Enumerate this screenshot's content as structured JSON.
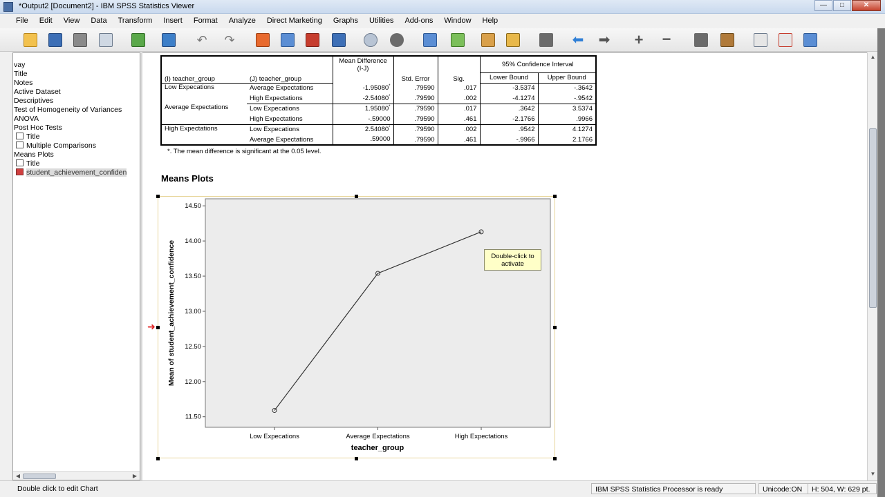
{
  "window": {
    "title": "*Output2 [Document2] - IBM SPSS Statistics Viewer",
    "minimize": "—",
    "maximize": "□",
    "close": "✕"
  },
  "menu": [
    "File",
    "Edit",
    "View",
    "Data",
    "Transform",
    "Insert",
    "Format",
    "Analyze",
    "Direct Marketing",
    "Graphs",
    "Utilities",
    "Add-ons",
    "Window",
    "Help"
  ],
  "toolbar": {
    "icons": [
      "open-icon",
      "save-icon",
      "print-icon",
      "print-preview-icon",
      "export-icon",
      "recall-dialog-icon",
      "undo-icon",
      "redo-icon",
      "goto-data-icon",
      "goto-case-icon",
      "goto-variable-icon",
      "variables-icon",
      "select-cases-icon",
      "show-all-icon",
      "hide-icon",
      "designate-window-icon",
      "insert-output-icon",
      "insert-title-icon",
      "insert-text-icon",
      "insert-chart-icon",
      "insert-map-icon",
      "insert-image-icon",
      "promote-icon",
      "demote-icon",
      "expand-icon",
      "collapse-icon",
      "show-icon",
      "hide-selected-icon",
      "navigation-icon",
      "toggle-icon",
      "custom-icon"
    ]
  },
  "outline": {
    "items": [
      {
        "label": "vay",
        "icon": false
      },
      {
        "label": "Title",
        "icon": false
      },
      {
        "label": "Notes",
        "icon": false
      },
      {
        "label": "Active Dataset",
        "icon": false
      },
      {
        "label": "Descriptives",
        "icon": false
      },
      {
        "label": "Test of Homogeneity of Variances",
        "icon": false
      },
      {
        "label": "ANOVA",
        "icon": false
      },
      {
        "label": "Post Hoc Tests",
        "icon": false
      },
      {
        "label": "Title",
        "icon": true
      },
      {
        "label": "Multiple Comparisons",
        "icon": true
      },
      {
        "label": "Means Plots",
        "icon": false
      },
      {
        "label": "Title",
        "icon": true
      },
      {
        "label": "student_achievement_confiden",
        "icon": true,
        "selected": true
      }
    ]
  },
  "table": {
    "headers": {
      "i_group": "(I) teacher_group",
      "j_group": "(J) teacher_group",
      "mean_diff": "Mean Difference (I-J)",
      "std_error": "Std. Error",
      "sig": "Sig.",
      "ci": "95% Confidence Interval",
      "lower": "Lower Bound",
      "upper": "Upper Bound"
    },
    "groups": [
      {
        "i": "Low Expecations",
        "rows": [
          {
            "j": "Average Expectations",
            "diff": "-1.95080",
            "star": "*",
            "se": ".79590",
            "sig": ".017",
            "lower": "-3.5374",
            "upper": "-.3642"
          },
          {
            "j": "High Expectations",
            "diff": "-2.54080",
            "star": "*",
            "se": ".79590",
            "sig": ".002",
            "lower": "-4.1274",
            "upper": "-.9542"
          }
        ]
      },
      {
        "i": "Average Expectations",
        "rows": [
          {
            "j": "Low Expecations",
            "diff": "1.95080",
            "star": "*",
            "se": ".79590",
            "sig": ".017",
            "lower": ".3642",
            "upper": "3.5374"
          },
          {
            "j": "High Expectations",
            "diff": "-.59000",
            "star": "",
            "se": ".79590",
            "sig": ".461",
            "lower": "-2.1766",
            "upper": ".9966"
          }
        ]
      },
      {
        "i": "High Expectations",
        "rows": [
          {
            "j": "Low Expecations",
            "diff": "2.54080",
            "star": "*",
            "se": ".79590",
            "sig": ".002",
            "lower": ".9542",
            "upper": "4.1274"
          },
          {
            "j": "Average Expectations",
            "diff": ".59000",
            "star": "",
            "se": ".79590",
            "sig": ".461",
            "lower": "-.9966",
            "upper": "2.1766"
          }
        ]
      }
    ],
    "footnote": "*. The mean difference is significant at the 0.05 level."
  },
  "plot_heading": "Means Plots",
  "chart_data": {
    "type": "line",
    "categories": [
      "Low Expecations",
      "Average Expectations",
      "High Expectations"
    ],
    "values": [
      11.59,
      13.54,
      14.13
    ],
    "xlabel": "teacher_group",
    "ylabel": "Mean of student_achievement_confidence",
    "ylim": [
      11.35,
      14.6
    ],
    "yticks": [
      "11.50",
      "12.00",
      "12.50",
      "13.00",
      "13.50",
      "14.00",
      "14.50"
    ],
    "ytick_values": [
      11.5,
      12.0,
      12.5,
      13.0,
      13.5,
      14.0,
      14.5
    ],
    "markers": "open-circle",
    "background": "#ececec",
    "line_color": "#333333"
  },
  "tooltip": "Double-click to activate",
  "status": {
    "hint": "Double click to edit Chart",
    "processor": "IBM SPSS Statistics Processor is ready",
    "unicode": "Unicode:ON",
    "size": "H: 504, W: 629 pt."
  }
}
